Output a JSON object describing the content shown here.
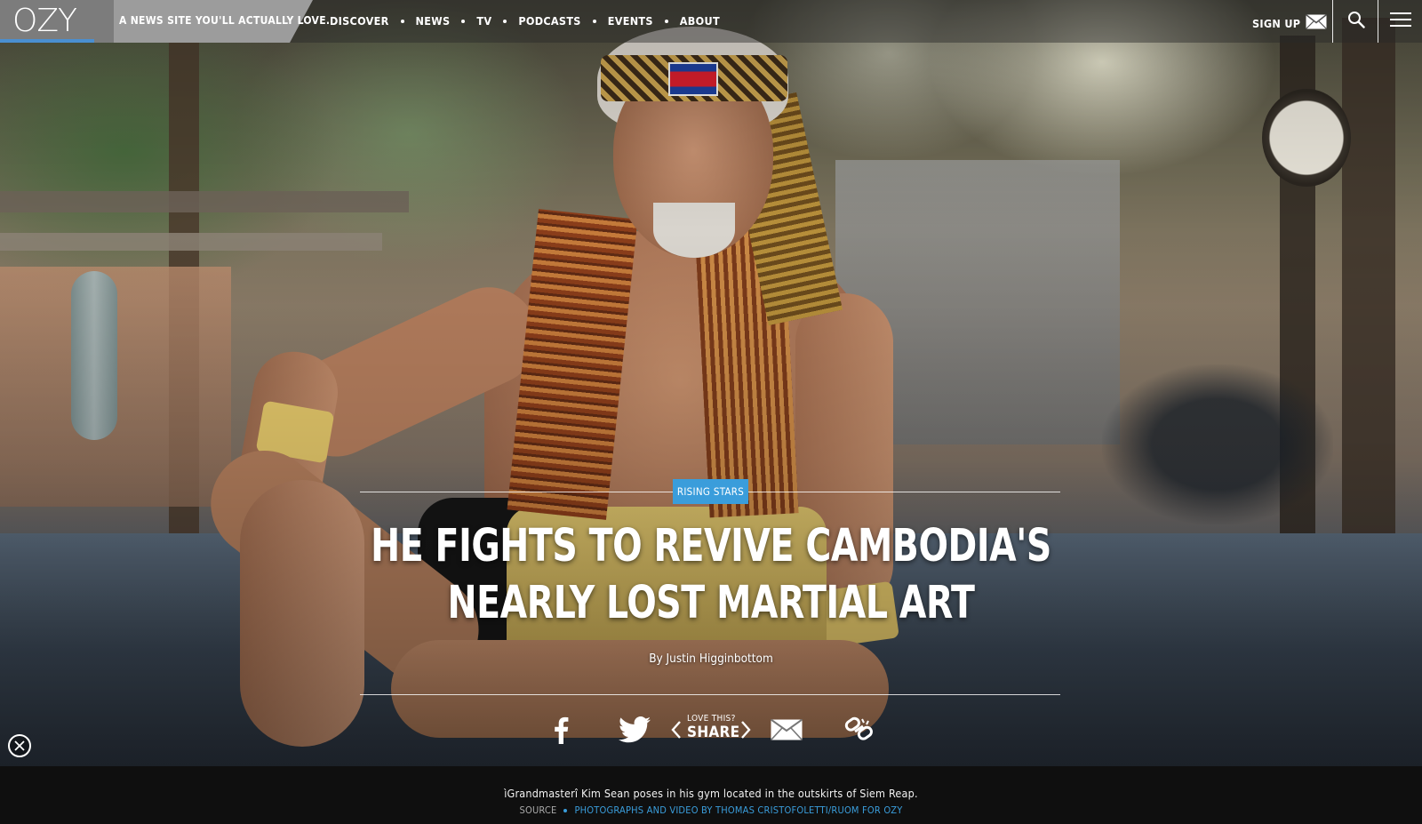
{
  "brand": {
    "logo": "OZY",
    "tagline": "A NEWS SITE YOU'LL ACTUALLY LOVE.",
    "accent_color": "#3a9ddb"
  },
  "nav": {
    "items": [
      {
        "label": "DISCOVER"
      },
      {
        "label": "NEWS"
      },
      {
        "label": "TV"
      },
      {
        "label": "PODCASTS"
      },
      {
        "label": "EVENTS"
      },
      {
        "label": "ABOUT"
      }
    ],
    "signup_label": "SIGN UP",
    "signup_icon": "envelope-icon",
    "search_icon": "search-icon",
    "menu_icon": "hamburger-menu-icon"
  },
  "article": {
    "category": "RISING STARS",
    "title": "HE FIGHTS TO REVIVE CAMBODIA'S NEARLY LOST MARTIAL ART",
    "byline": "By Justin Higginbottom"
  },
  "share": {
    "love_label": "LOVE THIS?",
    "share_label": "SHARE",
    "icons": [
      "facebook-icon",
      "twitter-icon",
      "email-icon",
      "link-icon"
    ]
  },
  "photo": {
    "caption": "ìGrandmasterî Kim Sean poses in his gym located in the outskirts of Siem Reap.",
    "source_label": "SOURCE",
    "credit": "PHOTOGRAPHS AND VIDEO BY THOMAS CRISTOFOLETTI/RUOM FOR OZY"
  }
}
